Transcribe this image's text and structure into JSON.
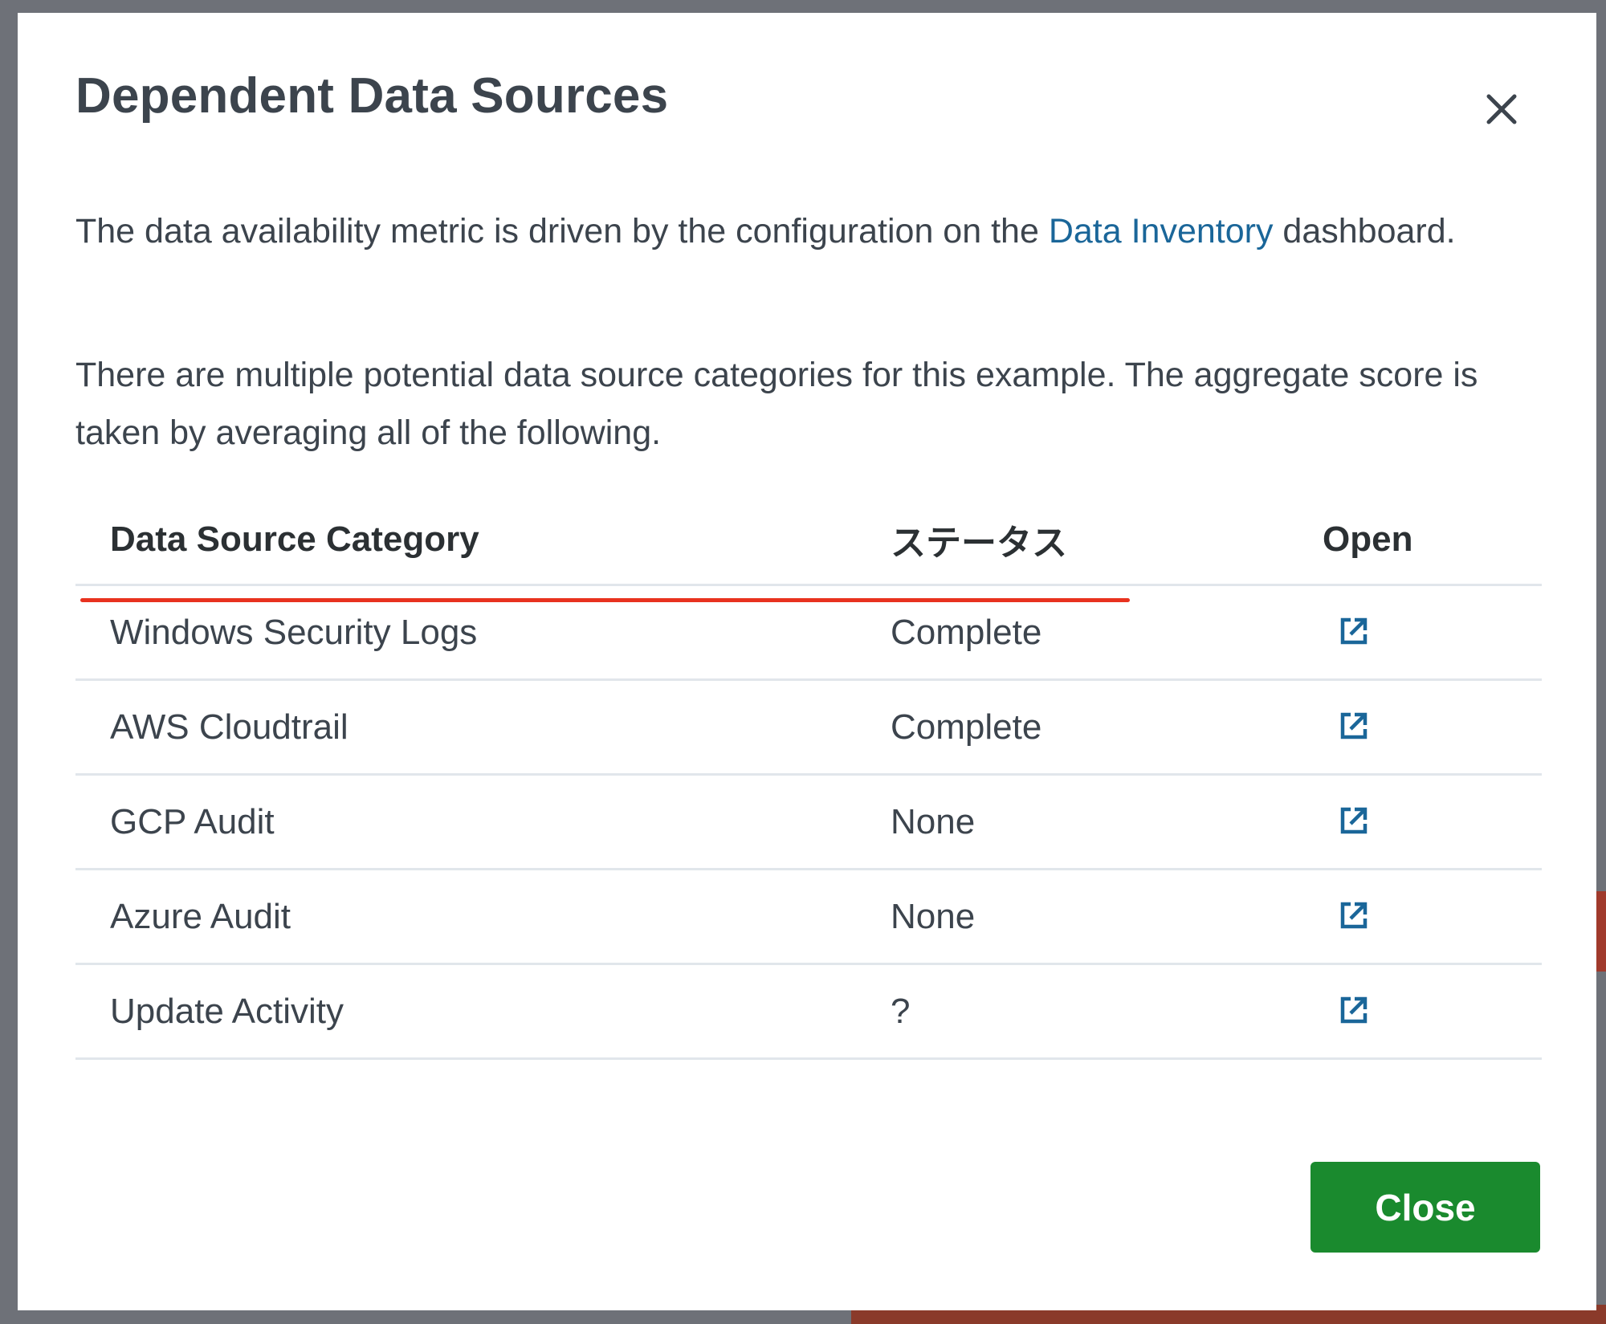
{
  "modal": {
    "title": "Dependent Data Sources",
    "close_icon": "close-icon",
    "para1_text": "The data availability metric is driven by the configuration on the ",
    "para1_link": "Data Inventory",
    "para1_suffix": " dashboard.",
    "para2_text": "There are multiple potential data source categories for this example. The aggregate score is taken by averaging all of the following.",
    "close_button_label": "Close"
  },
  "table": {
    "headers": {
      "category": "Data Source Category",
      "status": "ステータス",
      "open": "Open"
    },
    "rows": [
      {
        "category": "Windows Security Logs",
        "status": "Complete"
      },
      {
        "category": "AWS Cloudtrail",
        "status": "Complete"
      },
      {
        "category": "GCP Audit",
        "status": "None"
      },
      {
        "category": "Azure Audit",
        "status": "None"
      },
      {
        "category": "Update Activity",
        "status": "?"
      }
    ],
    "open_icon": "external-link-icon"
  },
  "colors": {
    "link": "#1a6699",
    "button": "#1a8a2e",
    "annotation": "#e8321f",
    "text": "#3c444d"
  }
}
